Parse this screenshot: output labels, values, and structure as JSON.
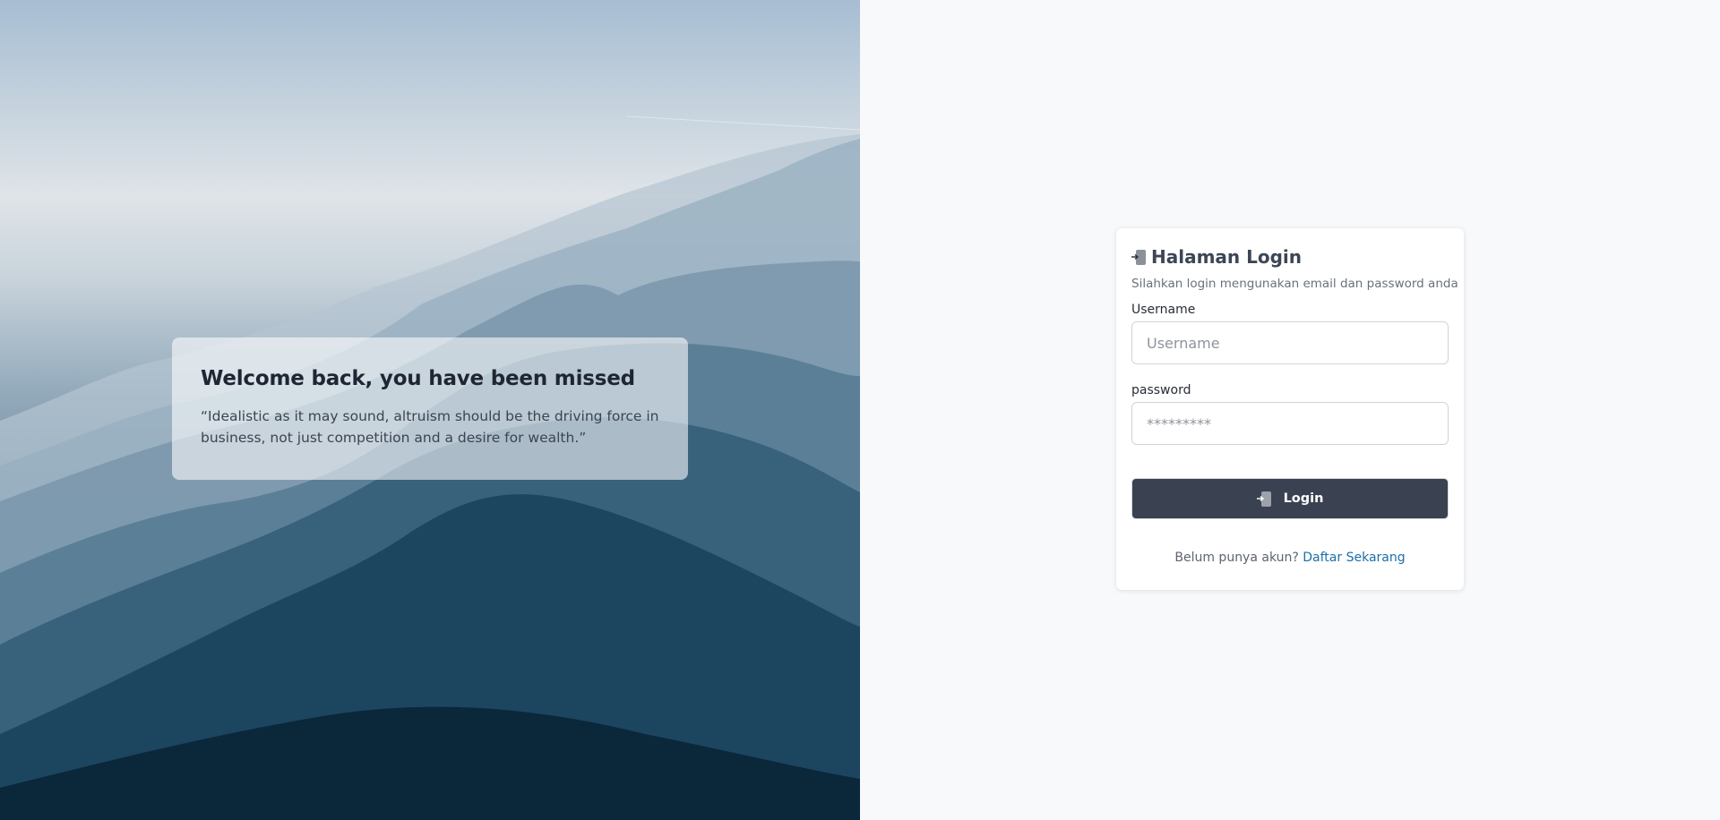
{
  "hero": {
    "title": "Welcome back, you have been missed",
    "quote": "“Idealistic as it may sound, altruism should be the driving force in business, not just competition and a desire for wealth.”"
  },
  "login": {
    "title": "Halaman Login",
    "title_icon": "login-icon",
    "subtitle": "Silahkan login mengunakan email dan password anda",
    "username_label": "Username",
    "username_placeholder": "Username",
    "username_value": "",
    "password_label": "password",
    "password_placeholder": "*********",
    "password_value": "",
    "button_label": "Login",
    "button_icon": "login-icon",
    "footer_prefix": "Belum punya akun?",
    "footer_link": "Daftar Sekarang"
  },
  "colors": {
    "button_bg": "#3a4251",
    "link": "#1c6fa8",
    "page_bg": "#f8f9fa"
  }
}
